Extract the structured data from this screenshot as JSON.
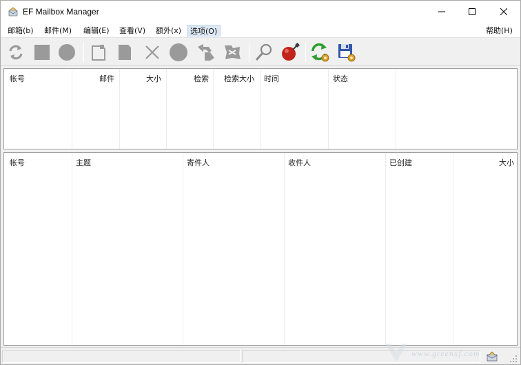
{
  "window": {
    "title": "EF Mailbox Manager"
  },
  "window_controls": {
    "minimize": "–",
    "maximize": "☐",
    "close": "✕"
  },
  "menubar": {
    "items": [
      {
        "label": "邮箱(b)"
      },
      {
        "label": "邮件(M)"
      },
      {
        "label": "编辑(E)"
      },
      {
        "label": "查看(V)"
      },
      {
        "label": "额外(x)"
      },
      {
        "label": "选项(O)"
      }
    ],
    "help": "帮助(H)"
  },
  "toolbar": {
    "buttons": [
      {
        "icon": "refresh-icon"
      },
      {
        "icon": "stop-square-icon"
      },
      {
        "icon": "circle-icon"
      },
      {
        "icon": "new-document-icon"
      },
      {
        "icon": "document-icon"
      },
      {
        "icon": "delete-x-icon"
      },
      {
        "icon": "circle-icon"
      },
      {
        "icon": "reply-icon"
      },
      {
        "icon": "forward-icon"
      },
      {
        "icon": "search-magnifier-icon"
      },
      {
        "icon": "pin-icon"
      },
      {
        "icon": "sync-gear-icon"
      },
      {
        "icon": "save-gear-icon"
      }
    ]
  },
  "accounts_table": {
    "columns": [
      {
        "label": "帐号"
      },
      {
        "label": "邮件"
      },
      {
        "label": "大小"
      },
      {
        "label": "检索"
      },
      {
        "label": "检索大小"
      },
      {
        "label": "时间"
      },
      {
        "label": "状态"
      }
    ],
    "rows": []
  },
  "messages_table": {
    "columns": [
      {
        "label": "帐号"
      },
      {
        "label": "主题"
      },
      {
        "label": "寄件人"
      },
      {
        "label": "收件人"
      },
      {
        "label": "已创建"
      },
      {
        "label": "大小"
      }
    ],
    "rows": []
  },
  "statusbar": {
    "icon": "mailbox-status-icon"
  },
  "watermark": {
    "text": "www.greenxf.com"
  },
  "colors": {
    "toolbar_gray": "#9a9a9a",
    "pin_red": "#c0241b",
    "sync_green": "#2e9e2e",
    "save_blue": "#3357a8",
    "gear_orange": "#e0a030"
  }
}
